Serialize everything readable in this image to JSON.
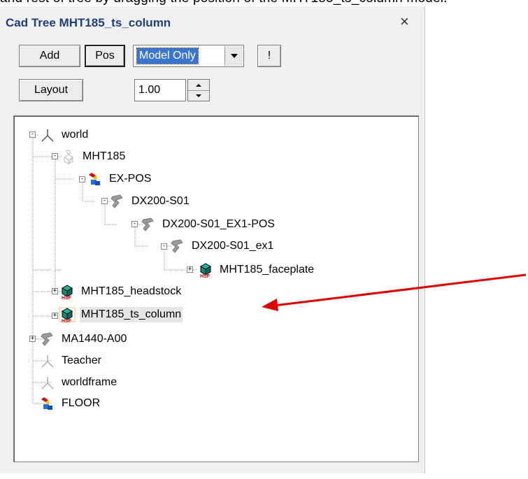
{
  "background_text": "and rest of tree by dragging the position of the MHT185_ts_column model.",
  "panel": {
    "title": "Cad Tree MHT185_ts_column",
    "close_glyph": "×"
  },
  "toolbar": {
    "add_label": "Add",
    "pos_label": "Pos",
    "mode_value": "Model Only",
    "exclaim_label": "!",
    "layout_label": "Layout",
    "scale_value": "1.00"
  },
  "tree": {
    "nodes": [
      {
        "label": "world",
        "icon": "frame-icon"
      },
      {
        "label": "MHT185",
        "icon": "ghost-part-icon"
      },
      {
        "label": "EX-POS",
        "icon": "position-icon"
      },
      {
        "label": "DX200-S01",
        "icon": "robot-icon"
      },
      {
        "label": "DX200-S01_EX1-POS",
        "icon": "robot-icon"
      },
      {
        "label": "DX200-S01_ex1",
        "icon": "robot-icon"
      },
      {
        "label": "MHT185_faceplate",
        "icon": "hsf-model-icon"
      },
      {
        "label": "MHT185_headstock",
        "icon": "hsf-model-icon"
      },
      {
        "label": "MHT185_ts_column",
        "icon": "hsf-model-icon"
      },
      {
        "label": "MA1440-A00",
        "icon": "robot-icon"
      },
      {
        "label": "Teacher",
        "icon": "frame-icon"
      },
      {
        "label": "worldframe",
        "icon": "frame-icon"
      },
      {
        "label": "FLOOR",
        "icon": "position-icon"
      }
    ]
  },
  "colors": {
    "title": "#1f3f7a",
    "selection": "#3a74d1",
    "annotation_arrow": "#e00000"
  }
}
